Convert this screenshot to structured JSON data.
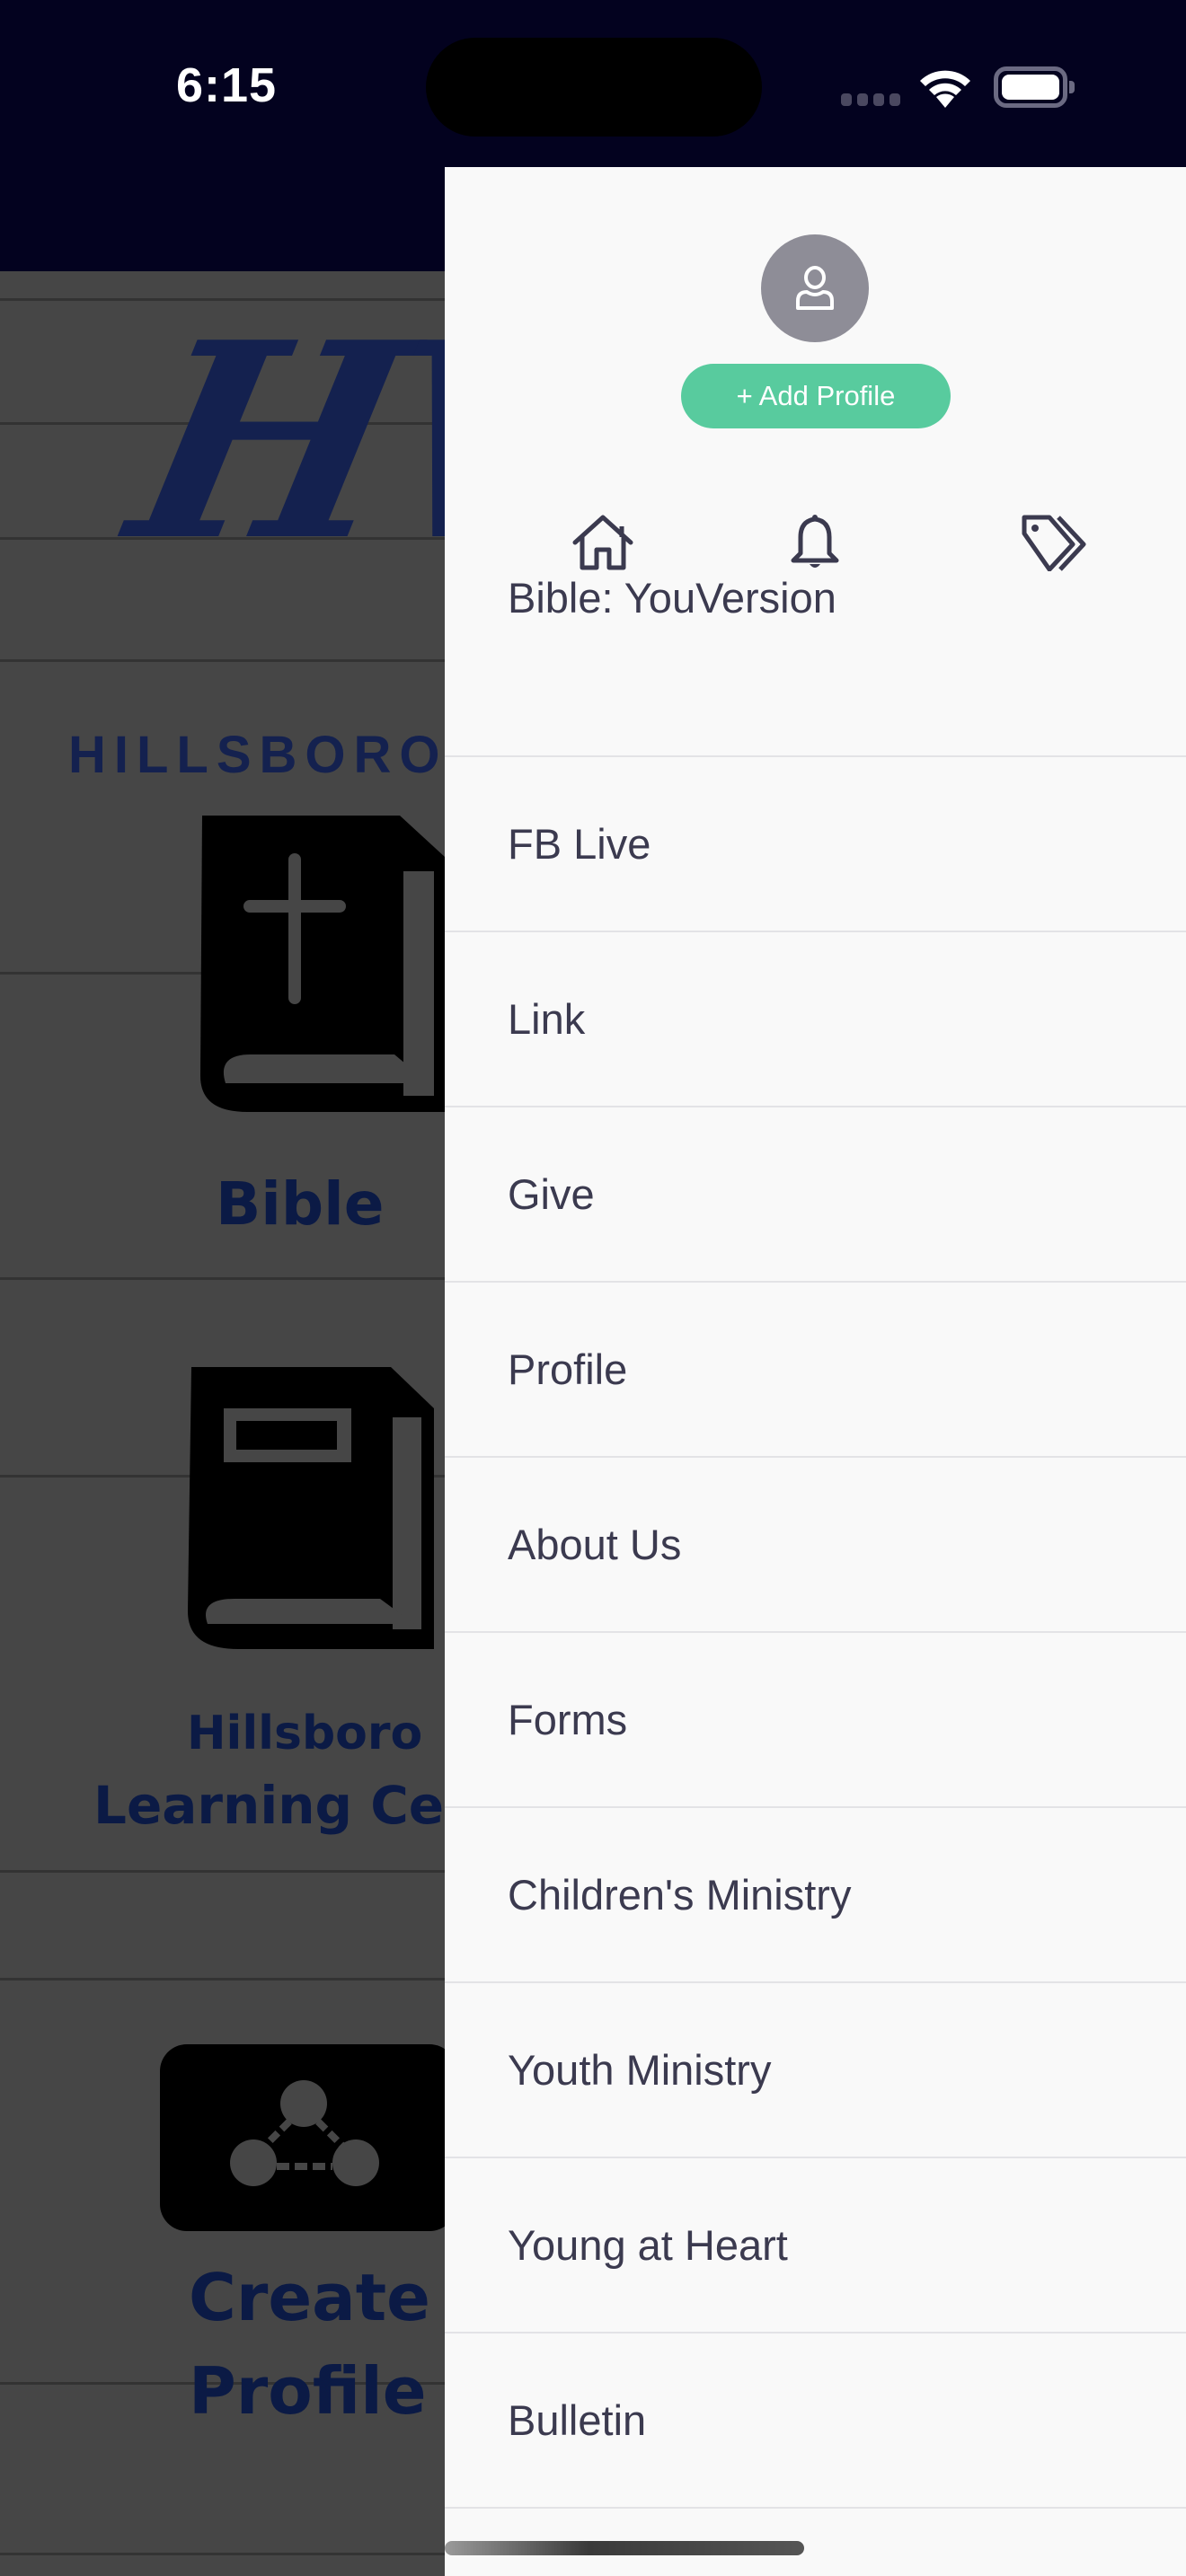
{
  "status_bar": {
    "time": "6:15",
    "signal_icon": "cellular-signal-icon",
    "wifi_icon": "wifi-icon",
    "battery_icon": "battery-icon"
  },
  "background_screen": {
    "logo_mark": "HV",
    "logo_text": "HILLSBORO",
    "tiles": [
      {
        "label": "Bible",
        "icon": "bible-icon"
      },
      {
        "label": "Hillsboro Learning Center",
        "line1": "Hillsboro",
        "line2": "Learning Cen",
        "icon": "book-icon"
      },
      {
        "label": "Create Profile",
        "line1": "Create",
        "line2": "Profile",
        "icon": "network-icon"
      }
    ]
  },
  "drawer": {
    "avatar_icon": "user-icon",
    "add_profile_label": "+ Add Profile",
    "quick_icons": [
      {
        "name": "home-icon"
      },
      {
        "name": "bell-icon"
      },
      {
        "name": "tags-icon"
      }
    ],
    "menu_items": [
      {
        "label": "Bible: YouVersion"
      },
      {
        "label": "FB Live"
      },
      {
        "label": "Link"
      },
      {
        "label": "Give"
      },
      {
        "label": "Profile"
      },
      {
        "label": "About Us"
      },
      {
        "label": "Forms"
      },
      {
        "label": "Children's Ministry"
      },
      {
        "label": "Youth Ministry"
      },
      {
        "label": "Young at Heart"
      },
      {
        "label": "Bulletin"
      }
    ]
  },
  "colors": {
    "header_bg": "#03021f",
    "drawer_bg": "#f9f9f9",
    "accent_green": "#58cb9e",
    "menu_text": "#3b3a4f",
    "avatar_bg": "#8e8d97",
    "brand_blue": "#14214f"
  }
}
